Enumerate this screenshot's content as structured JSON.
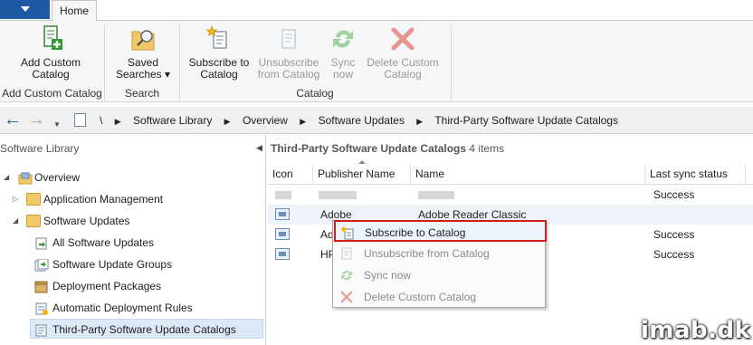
{
  "ribbon": {
    "tab_home": "Home",
    "buttons": {
      "add_custom_catalog": "Add Custom\nCatalog",
      "saved_searches": "Saved\nSearches ▾",
      "subscribe": "Subscribe to\nCatalog",
      "unsubscribe": "Unsubscribe\nfrom Catalog",
      "sync_now": "Sync\nnow",
      "delete_custom": "Delete Custom\nCatalog"
    },
    "groups": {
      "add_custom_catalog": "Add Custom Catalog",
      "search": "Search",
      "catalog": "Catalog"
    }
  },
  "address": {
    "root": "\\",
    "crumbs": [
      "Software Library",
      "Overview",
      "Software Updates",
      "Third-Party Software Update Catalogs"
    ]
  },
  "nav": {
    "header": "Software Library",
    "items": [
      {
        "label": "Overview"
      },
      {
        "label": "Application Management"
      },
      {
        "label": "Software Updates"
      },
      {
        "label": "All Software Updates"
      },
      {
        "label": "Software Update Groups"
      },
      {
        "label": "Deployment Packages"
      },
      {
        "label": "Automatic Deployment Rules"
      },
      {
        "label": "Third-Party Software Update Catalogs"
      }
    ]
  },
  "content": {
    "title": "Third-Party Software Update Catalogs",
    "count": "4 items",
    "columns": [
      "Icon",
      "Publisher Name",
      "Name",
      "Last sync status"
    ],
    "rows": [
      {
        "publisher": "",
        "name": "",
        "status": "Success"
      },
      {
        "publisher": "Adobe",
        "name": "Adobe Reader Classic",
        "status": ""
      },
      {
        "publisher": "Ad",
        "name": "",
        "status": "Success"
      },
      {
        "publisher": "HP",
        "name": "",
        "status": "Success"
      }
    ]
  },
  "context_menu": {
    "items": [
      {
        "label": "Subscribe to Catalog"
      },
      {
        "label": "Unsubscribe from Catalog"
      },
      {
        "label": "Sync now"
      },
      {
        "label": "Delete Custom Catalog"
      }
    ]
  },
  "watermark": "imab.dk",
  "colors": {
    "accent": "#1c5aa6",
    "highlight_border": "#d01c1c",
    "selection": "#dde9f7"
  }
}
